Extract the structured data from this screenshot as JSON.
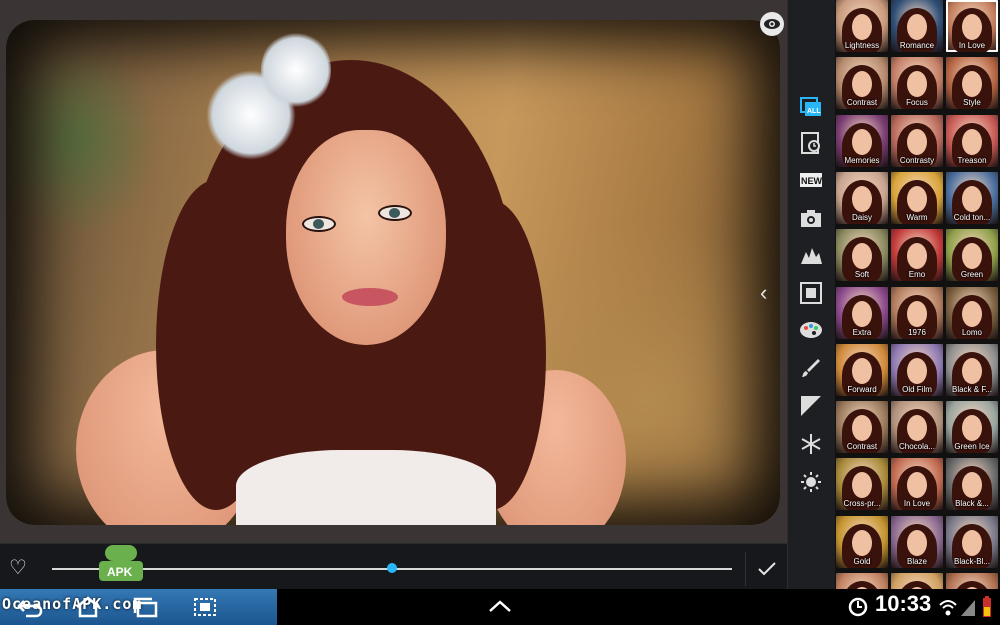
{
  "editor": {
    "slider_value_percent": 50
  },
  "toolbar": {
    "tools": [
      {
        "id": "all",
        "icon": "all-filters-icon",
        "badge": "ALL"
      },
      {
        "id": "recent",
        "icon": "recent-clock-icon"
      },
      {
        "id": "new",
        "icon": "new-badge-icon",
        "badge": "NEW"
      },
      {
        "id": "camera",
        "icon": "camera-icon"
      },
      {
        "id": "landscape",
        "icon": "landscape-icon"
      },
      {
        "id": "frame",
        "icon": "frame-icon"
      },
      {
        "id": "palette",
        "icon": "palette-icon"
      },
      {
        "id": "brush",
        "icon": "brush-icon"
      },
      {
        "id": "contrast",
        "icon": "contrast-icon"
      },
      {
        "id": "snowflake",
        "icon": "snowflake-icon"
      },
      {
        "id": "brightness",
        "icon": "sun-icon"
      }
    ]
  },
  "filters": [
    {
      "label": "Lightness",
      "tint": "#c89a7d"
    },
    {
      "label": "Romance",
      "tint": "#2f4f78"
    },
    {
      "label": "In Love",
      "tint": "#c07a5a",
      "selected": true
    },
    {
      "label": "Contrast",
      "tint": "#b58a6d"
    },
    {
      "label": "Focus",
      "tint": "#c27d65"
    },
    {
      "label": "Style",
      "tint": "#b56644"
    },
    {
      "label": "Memories",
      "tint": "#7a3d73"
    },
    {
      "label": "Contrasty",
      "tint": "#b96a5c"
    },
    {
      "label": "Treason",
      "tint": "#c75a55"
    },
    {
      "label": "Daisy",
      "tint": "#c7a48f"
    },
    {
      "label": "Warm",
      "tint": "#d9a43a"
    },
    {
      "label": "Cold ton...",
      "tint": "#4a6f9e"
    },
    {
      "label": "Soft",
      "tint": "#8a8a60"
    },
    {
      "label": "Emo",
      "tint": "#c23a3a"
    },
    {
      "label": "Green",
      "tint": "#8fa04a"
    },
    {
      "label": "Extra",
      "tint": "#8b4a8c"
    },
    {
      "label": "1976",
      "tint": "#b07a5c"
    },
    {
      "label": "Lomo",
      "tint": "#7a6040"
    },
    {
      "label": "Forward",
      "tint": "#d08a3a"
    },
    {
      "label": "Old Film",
      "tint": "#8f7ab4"
    },
    {
      "label": "Black & F...",
      "tint": "#909090"
    },
    {
      "label": "Contrast",
      "tint": "#9a7a5c"
    },
    {
      "label": "Chocola...",
      "tint": "#b0907a"
    },
    {
      "label": "Green Ice",
      "tint": "#9aa6a0"
    },
    {
      "label": "Cross-pr...",
      "tint": "#a88a3a"
    },
    {
      "label": "In Love",
      "tint": "#c06a50"
    },
    {
      "label": "Black &...",
      "tint": "#6a6a6a"
    },
    {
      "label": "Gold",
      "tint": "#c59530"
    },
    {
      "label": "Blaze",
      "tint": "#8a6a90"
    },
    {
      "label": "Black-Bl...",
      "tint": "#7a7a8a"
    },
    {
      "label": "",
      "tint": "#c08060"
    },
    {
      "label": "",
      "tint": "#d0a060"
    },
    {
      "label": "",
      "tint": "#b07050"
    }
  ],
  "watermark": {
    "text": "OceanofAPK.com",
    "apk_label": "APK"
  },
  "status": {
    "time": "10:33"
  }
}
